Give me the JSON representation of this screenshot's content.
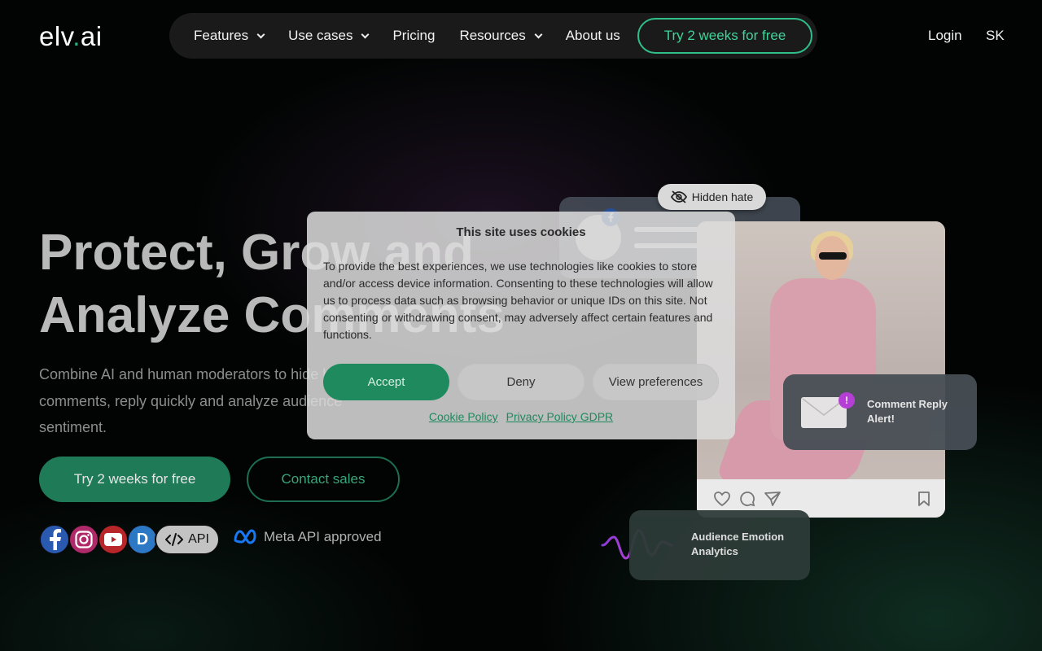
{
  "header": {
    "logo_text_main": "elv",
    "logo_text_dot": ".",
    "logo_text_tail": "ai",
    "nav": [
      {
        "label": "Features",
        "has_dropdown": true
      },
      {
        "label": "Use cases",
        "has_dropdown": true
      },
      {
        "label": "Pricing",
        "has_dropdown": false
      },
      {
        "label": "Resources",
        "has_dropdown": true
      },
      {
        "label": "About us",
        "has_dropdown": false
      }
    ],
    "cta_label": "Try 2 weeks for free",
    "login_label": "Login",
    "language_label": "SK"
  },
  "hero": {
    "title": "Protect, Grow and Analyze Comments",
    "subtitle": "Combine AI and human moderators to hide hate comments, reply quickly and analyze audience sentiment.",
    "primary_button": "Try 2 weeks for free",
    "secondary_button": "Contact sales",
    "api_label": "API",
    "meta_label": "Meta API approved",
    "platform_icons": [
      "facebook-icon",
      "instagram-icon",
      "youtube-icon",
      "d-platform-icon"
    ]
  },
  "visuals": {
    "hidden_hate_label": "Hidden hate",
    "alert_label": "Comment Reply Alert!",
    "alert_badge": "!",
    "emotion_label": "Audience Emotion Analytics"
  },
  "cookie_banner": {
    "title": "This site uses cookies",
    "text": "To provide the best experiences, we use technologies like cookies to store and/or access device information. Consenting to these technologies will allow us to process data such as browsing behavior or unique IDs on this site. Not consenting or withdrawing consent, may adversely affect certain features and functions.",
    "accept_label": "Accept",
    "deny_label": "Deny",
    "preferences_label": "View preferences",
    "cookie_policy_link": "Cookie Policy",
    "privacy_policy_link": "Privacy Policy GDPR"
  },
  "colors": {
    "brand_green": "#27b07e",
    "background": "#000000",
    "accent_purple": "#b43ad8"
  }
}
